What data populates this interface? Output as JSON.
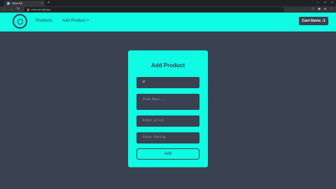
{
  "browser": {
    "tab_title": "Inline Ref",
    "url": "inline-ref-sdfj.app",
    "new_tab_label": "+"
  },
  "navbar": {
    "products_label": "Products",
    "add_product_label": "Add Product +",
    "cart_label": "Cart Items :1"
  },
  "form": {
    "title": "Add Product",
    "name_value": "d",
    "description_placeholder": "Item Desc...",
    "price_placeholder": "Enter price",
    "rating_placeholder": "Enter Rating",
    "add_label": "Add"
  },
  "colors": {
    "accent": "#0ffbe4",
    "background": "#3a4150"
  }
}
